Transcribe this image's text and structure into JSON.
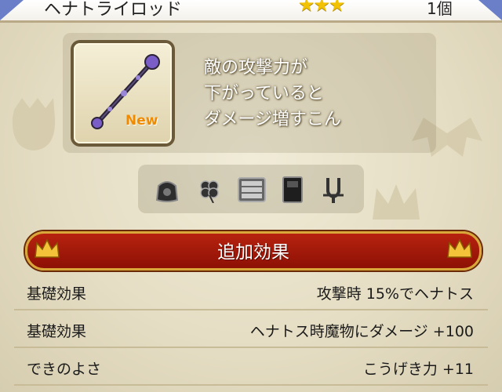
{
  "header": {
    "item_name": "ヘナトライロッド",
    "stars": "★★★",
    "count": "1個"
  },
  "item": {
    "new_badge": "New",
    "description_lines": [
      "敵の攻撃力が",
      "下がっていると",
      "ダメージ増すこん"
    ]
  },
  "icons": [
    "bag-icon",
    "clover-icon",
    "drawer-icon",
    "book-icon",
    "fork-icon"
  ],
  "banner": {
    "title": "追加効果"
  },
  "effects": [
    {
      "label": "基礎効果",
      "value": "攻撃時 15%でヘナトス"
    },
    {
      "label": "基礎効果",
      "value": "ヘナトス時魔物にダメージ +100"
    },
    {
      "label": "できのよさ",
      "value": "こうげき力 +11"
    }
  ],
  "colors": {
    "banner_red": "#a0190a",
    "gold": "#d9a63a",
    "star": "#f2c200",
    "new": "#f08a00"
  }
}
